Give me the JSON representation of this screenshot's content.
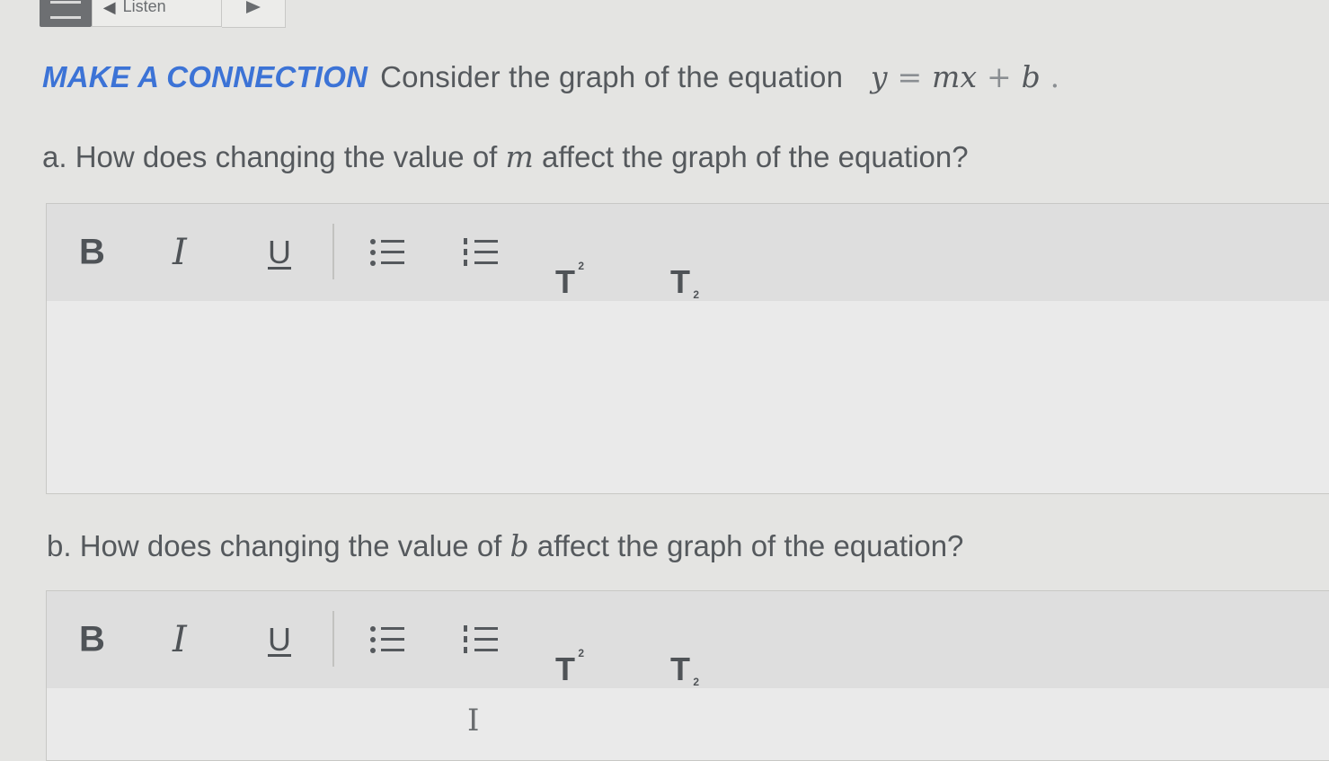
{
  "toolbar": {
    "listen_label": "Listen"
  },
  "prompt": {
    "kicker": "MAKE A CONNECTION",
    "text": "Consider the graph of the equation",
    "eq_y": "y",
    "eq_eq": "=",
    "eq_mx": "mx",
    "eq_plus": "+",
    "eq_b": "b",
    "eq_end": "."
  },
  "questions": [
    {
      "prefix": "a. How does changing the value of ",
      "var": "m",
      "suffix": " affect the graph of the equation?"
    },
    {
      "prefix": "b. How does changing the value of ",
      "var": "b",
      "suffix": " affect the graph of the equation?"
    }
  ],
  "editor_toolbar": {
    "bold": "B",
    "italic": "I",
    "underline": "U",
    "superscript": "T",
    "superscript_mark": "2",
    "subscript": "T",
    "subscript_mark": "2"
  },
  "icons": {
    "menu": "menu-icon",
    "speaker": "speaker-icon",
    "play": "play-icon",
    "bullet_list": "bullet-list-icon",
    "numbered_list": "numbered-list-icon",
    "text_cursor": "text-cursor-icon"
  },
  "colors": {
    "accent": "#3c73d6",
    "text": "#55595d",
    "toolbar_bg": "#dedede",
    "page_bg": "#e4e4e2"
  }
}
